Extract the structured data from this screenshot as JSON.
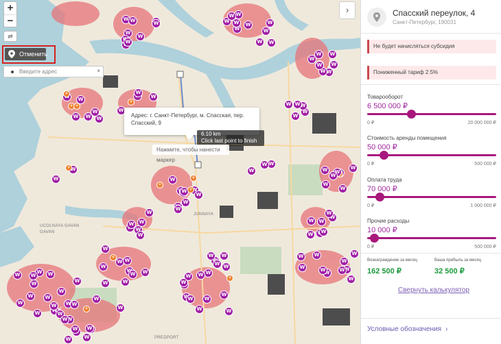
{
  "map": {
    "zoom_in": "+",
    "zoom_out": "−",
    "ruler_icon": "ruler-icon",
    "cancel_label": "Отменить",
    "search_placeholder": "Введите адрес",
    "search_clear": "×",
    "popup_line1": "Адрес: г. Санкт-Петербург, м. Спасская, пер.",
    "popup_line2": "Спасский, 9",
    "distance": "6.10 km",
    "finish_hint": "Click last point to finish line.",
    "marker_hint": "Нажмите, чтобы нанести маркер",
    "panel_toggle": "›",
    "labels": [
      "UCOLNAYA GAVAN",
      "JUNNAYA",
      "PREDPORT",
      "GAVAN"
    ],
    "marker_letter": "W",
    "colors": {
      "marker": "#a11fa6",
      "water": "#aed1db",
      "heat": "#e8747a"
    }
  },
  "panel": {
    "title": "Спасский переулок, 4",
    "subtitle": "Санкт-Петербург, 190031",
    "alerts": [
      "Не будет начисляться субсидия",
      "Пониженный тариф 2.5%"
    ],
    "sliders": [
      {
        "label": "Товарооборот",
        "value": "6 500 000 ₽",
        "min": "0 ₽",
        "max": "20 000 000 ₽",
        "fraction": 0.33
      },
      {
        "label": "Стоимость аренды помещения",
        "value": "50 000 ₽",
        "min": "0 ₽",
        "max": "500 000 ₽",
        "fraction": 0.1
      },
      {
        "label": "Оплата труда",
        "value": "70 000 ₽",
        "min": "0 ₽",
        "max": "1 000 000 ₽",
        "fraction": 0.07
      },
      {
        "label": "Прочие расходы",
        "value": "10 000 ₽",
        "min": "0 ₽",
        "max": "500 000 ₽",
        "fraction": 0.02
      }
    ],
    "results": [
      {
        "label": "Вознаграждение за месяц",
        "value": "162 500 ₽"
      },
      {
        "label": "Ваша прибыль за месяц",
        "value": "32 500 ₽"
      }
    ],
    "collapse_label": "Свернуть калькулятор",
    "legend_label": "Условные обозначения",
    "accent": "#a8187c"
  }
}
